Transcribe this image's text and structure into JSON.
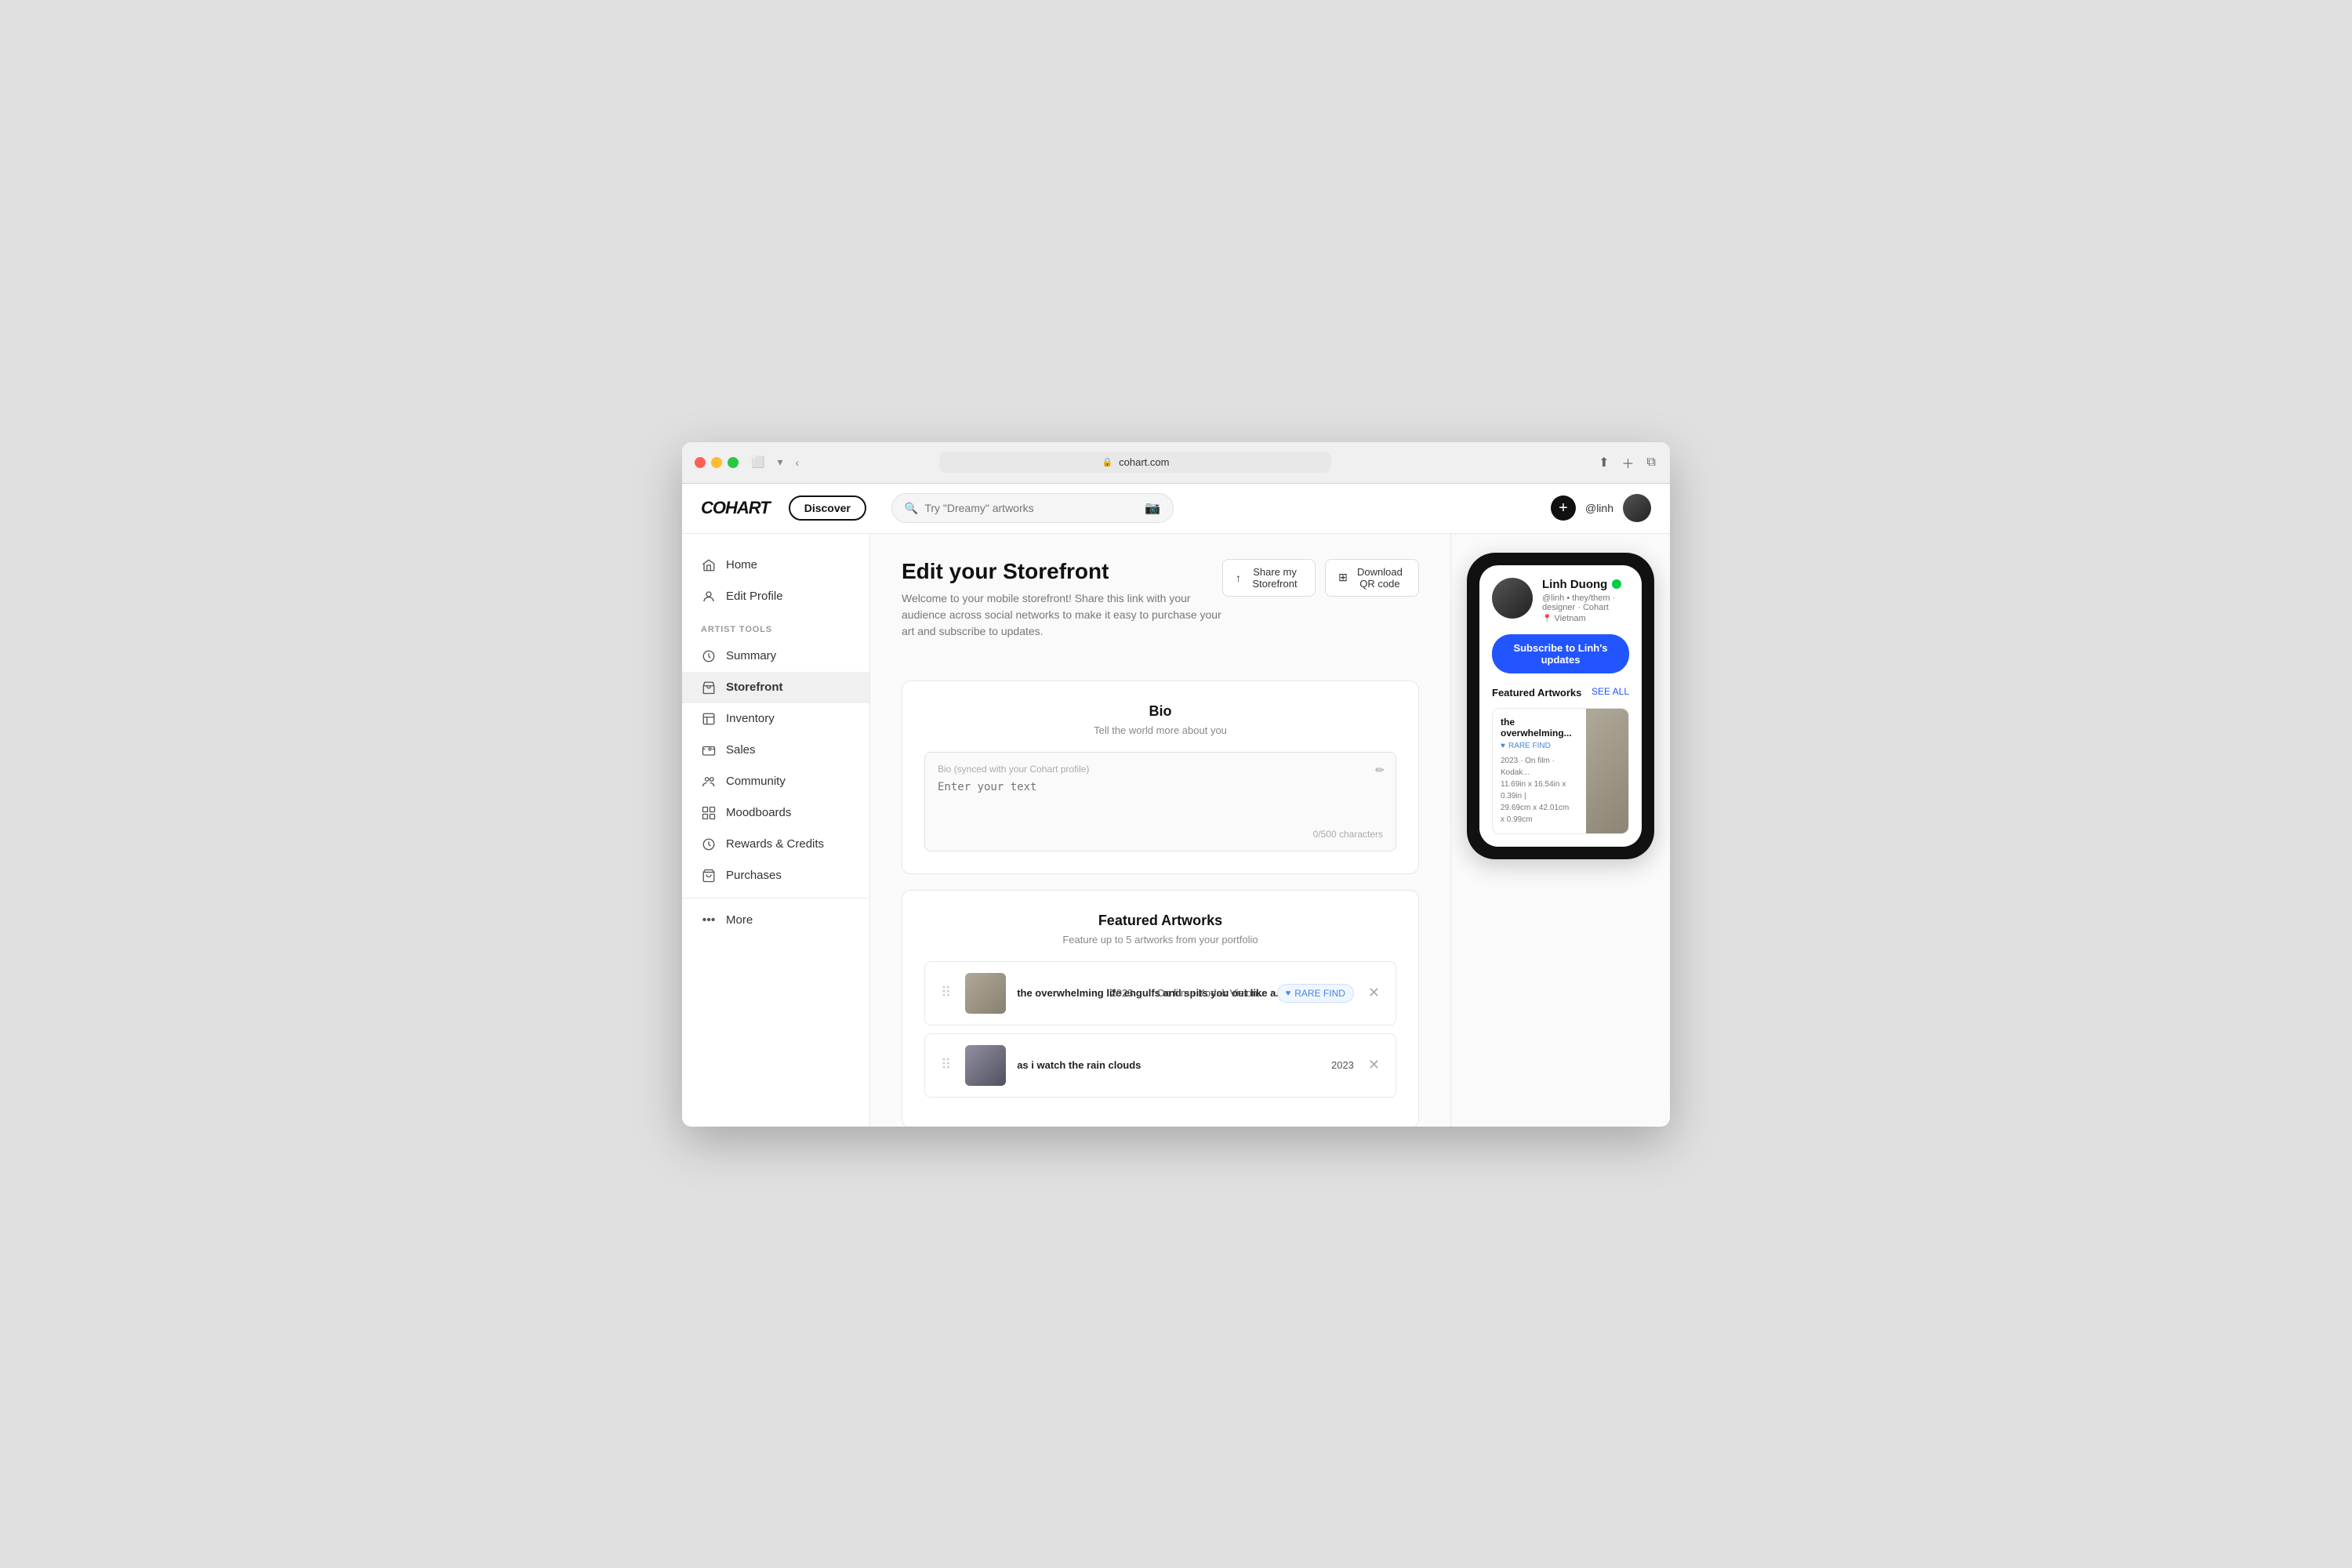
{
  "browser": {
    "url": "cohart.com",
    "address_display": "cohart.com 🔒"
  },
  "topnav": {
    "logo": "COHART",
    "discover_label": "Discover",
    "search_placeholder": "Try \"Dreamy\" artworks",
    "username": "@linh",
    "add_button_label": "+"
  },
  "sidebar": {
    "nav_items": [
      {
        "id": "home",
        "label": "Home",
        "icon": "home-icon"
      },
      {
        "id": "edit-profile",
        "label": "Edit Profile",
        "icon": "user-icon"
      }
    ],
    "section_label": "ARTIST TOOLS",
    "artist_tools": [
      {
        "id": "summary",
        "label": "Summary",
        "icon": "summary-icon"
      },
      {
        "id": "storefront",
        "label": "Storefront",
        "icon": "storefront-icon",
        "active": true
      },
      {
        "id": "inventory",
        "label": "Inventory",
        "icon": "inventory-icon"
      },
      {
        "id": "sales",
        "label": "Sales",
        "icon": "sales-icon"
      },
      {
        "id": "community",
        "label": "Community",
        "icon": "community-icon"
      },
      {
        "id": "moodboards",
        "label": "Moodboards",
        "icon": "moodboards-icon"
      },
      {
        "id": "rewards",
        "label": "Rewards & Credits",
        "icon": "rewards-icon"
      },
      {
        "id": "purchases",
        "label": "Purchases",
        "icon": "purchases-icon"
      }
    ],
    "more_label": "More"
  },
  "content": {
    "page_title": "Edit your Storefront",
    "page_subtitle": "Welcome to your mobile storefront! Share this link with your audience across social networks to make it easy to purchase your art and subscribe to updates.",
    "share_btn": "Share my Storefront",
    "qr_btn": "Download QR code",
    "bio_card": {
      "title": "Bio",
      "subtitle": "Tell the world more about you",
      "label": "Bio (synced with your Cohart profile)",
      "placeholder": "Enter your text",
      "char_count": "0/500 characters"
    },
    "artworks_card": {
      "title": "Featured Artworks",
      "subtitle": "Feature up to 5 artworks from your portfolio",
      "items": [
        {
          "title": "the overwhelming life engulfs and spits you out like a...",
          "year": "2023",
          "medium": "On film · Kodak Vision...",
          "badge": "RARE FIND",
          "has_badge": true
        },
        {
          "title": "as i watch the rain clouds",
          "year": "2023",
          "medium": "",
          "badge": "",
          "has_badge": false
        }
      ]
    }
  },
  "preview": {
    "profile": {
      "name": "Linh Duong",
      "handle": "@linh  •  they/them · designer · Cohart",
      "location": "Vietnam",
      "subscribe_label": "Subscribe to Linh's updates"
    },
    "featured_section": "Featured Artworks",
    "see_all": "SEE ALL",
    "artwork": {
      "title": "the overwhelming...",
      "rare_label": "RARE FIND",
      "meta_line1": "2023 · On film · Kodak...",
      "meta_line2": "11.69in x 16.54in x 0.39in |",
      "meta_line3": "29.69cm x 42.01cm x 0.99cm"
    }
  }
}
